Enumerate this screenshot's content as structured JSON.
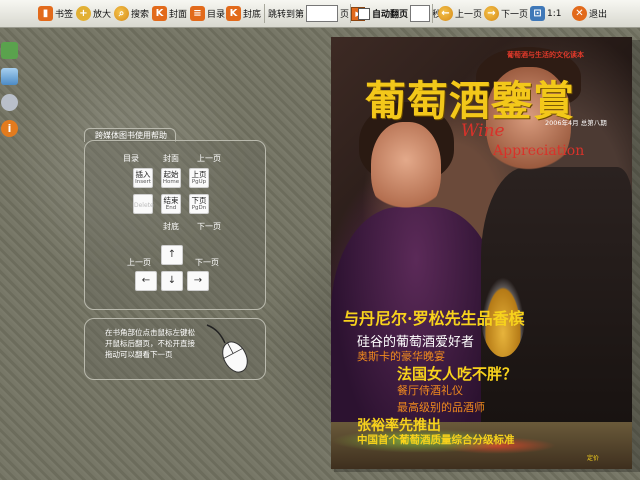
{
  "toolbar": {
    "bookmark": "书签",
    "zoom": "放大",
    "search": "搜索",
    "cover": "封面",
    "toc": "目录",
    "back_cover": "封底",
    "goto_label": "跳转到第",
    "goto_value": "",
    "goto_unit": "页",
    "auto_flip": "自动翻页",
    "auto_flip_value": "",
    "seconds": "秒",
    "prev_page": "上一页",
    "next_page": "下一页",
    "ratio": "1:1",
    "exit": "退出"
  },
  "help": {
    "title": "跨媒体图书使用帮助",
    "label_toc": "目录",
    "label_cover": "封面",
    "label_prev": "上一页",
    "label_back_cover": "封底",
    "label_next": "下一页",
    "keys": [
      {
        "top": "插入",
        "bottom": "Insert"
      },
      {
        "top": "起始",
        "bottom": "Home"
      },
      {
        "top": "上页",
        "bottom": "PgUp"
      },
      {
        "top": "Delete",
        "bottom": ""
      },
      {
        "top": "结束",
        "bottom": "End"
      },
      {
        "top": "下页",
        "bottom": "PgDn"
      }
    ],
    "arrow_prev_label": "上一页",
    "arrow_next_label": "下一页",
    "arrows": {
      "up": "↑",
      "left": "←",
      "down": "↓",
      "right": "→"
    },
    "mouse_text": "在书角部位点击鼠标左键松开鼠标后翻页，不松开直接拖动可以翻看下一页"
  },
  "cover": {
    "tagline": "葡萄酒与生活的文化读本",
    "title": "葡萄酒鑒賞",
    "issue": "2006年4月 总第八期",
    "english_1": "Wine",
    "english_2": "Appreciation",
    "headline_1": "与丹尼尔·罗松先生品香槟",
    "headline_2": "硅谷的葡萄酒爱好者",
    "headline_3": "奥斯卡的豪华晚宴",
    "headline_4": "法国女人吃不胖？",
    "headline_5": "餐厅侍酒礼仪",
    "headline_6": "最高级别的品酒师",
    "headline_7": "张裕率先推出",
    "headline_8": "中国首个葡萄酒质量综合分级标准",
    "price": "定价"
  }
}
